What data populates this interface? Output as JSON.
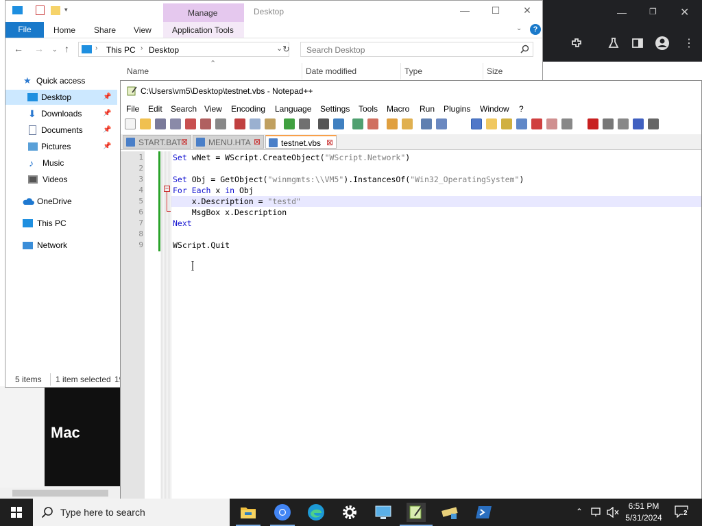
{
  "explorer": {
    "ribbon_context_tab": "Manage",
    "window_title": "Desktop",
    "tabs": [
      "File",
      "Home",
      "Share",
      "View",
      "Application Tools"
    ],
    "breadcrumb": [
      "This PC",
      "Desktop"
    ],
    "search_placeholder": "Search Desktop",
    "columns": [
      "Name",
      "Date modified",
      "Type",
      "Size"
    ],
    "nav_items": [
      {
        "label": "Quick access",
        "icon": "star-icon"
      },
      {
        "label": "Desktop",
        "icon": "desktop-icon",
        "pinned": true,
        "selected": true
      },
      {
        "label": "Downloads",
        "icon": "download-icon",
        "pinned": true
      },
      {
        "label": "Documents",
        "icon": "documents-icon",
        "pinned": true
      },
      {
        "label": "Pictures",
        "icon": "pictures-icon",
        "pinned": true
      },
      {
        "label": "Music",
        "icon": "music-icon"
      },
      {
        "label": "Videos",
        "icon": "videos-icon"
      },
      {
        "label": "OneDrive",
        "icon": "cloud-icon"
      },
      {
        "label": "This PC",
        "icon": "computer-icon"
      },
      {
        "label": "Network",
        "icon": "network-icon"
      }
    ],
    "status_items": "5 items",
    "status_selected": "1 item selected",
    "status_size_fragment": "19"
  },
  "browser": {
    "thumbnail_text": "Mac"
  },
  "notepad": {
    "title": "C:\\Users\\vm5\\Desktop\\testnet.vbs - Notepad++",
    "menu": [
      "File",
      "Edit",
      "Search",
      "View",
      "Encoding",
      "Language",
      "Settings",
      "Tools",
      "Macro",
      "Run",
      "Plugins",
      "Window",
      "?"
    ],
    "tabs": [
      {
        "label": "START.BAT",
        "active": false
      },
      {
        "label": "MENU.HTA",
        "active": false
      },
      {
        "label": "testnet.vbs",
        "active": true
      }
    ],
    "line_numbers": [
      "1",
      "2",
      "3",
      "4",
      "5",
      "6",
      "7",
      "8",
      "9"
    ],
    "code": [
      [
        {
          "t": "Set",
          "c": "kw"
        },
        {
          "t": " wNet = WScript.CreateObject(",
          "c": ""
        },
        {
          "t": "\"WScript.Network\"",
          "c": "str"
        },
        {
          "t": ")",
          "c": ""
        }
      ],
      [],
      [
        {
          "t": "Set",
          "c": "kw"
        },
        {
          "t": " Obj = GetObject(",
          "c": ""
        },
        {
          "t": "\"winmgmts:\\\\VM5\"",
          "c": "str"
        },
        {
          "t": ").InstancesOf(",
          "c": ""
        },
        {
          "t": "\"Win32_OperatingSystem\"",
          "c": "str"
        },
        {
          "t": ")",
          "c": ""
        }
      ],
      [
        {
          "t": "For",
          "c": "kw"
        },
        {
          "t": " ",
          "c": ""
        },
        {
          "t": "Each",
          "c": "kw"
        },
        {
          "t": " x ",
          "c": ""
        },
        {
          "t": "in",
          "c": "kw"
        },
        {
          "t": " Obj",
          "c": ""
        }
      ],
      [
        {
          "t": "    x.Description = ",
          "c": ""
        },
        {
          "t": "\"testd\"",
          "c": "str"
        }
      ],
      [
        {
          "t": "    MsgBox x.Description",
          "c": ""
        }
      ],
      [
        {
          "t": "Next",
          "c": "kw"
        }
      ],
      [],
      [
        {
          "t": "WScript.Quit",
          "c": ""
        }
      ]
    ]
  },
  "taskbar": {
    "search_placeholder": "Type here to search",
    "time": "6:51 PM",
    "date": "5/31/2024",
    "notification_count": "2",
    "apps": [
      "file-explorer-icon",
      "chrome-icon",
      "edge-icon",
      "settings-icon",
      "remote-desktop-icon",
      "notepadpp-icon",
      "tools-icon",
      "powershell-icon"
    ]
  },
  "colors": {
    "accent": "#1979ca",
    "manage_tab": "#e5c8ee",
    "keyword": "#1010d0",
    "string": "#808080",
    "taskbar": "#1f1f1f"
  }
}
